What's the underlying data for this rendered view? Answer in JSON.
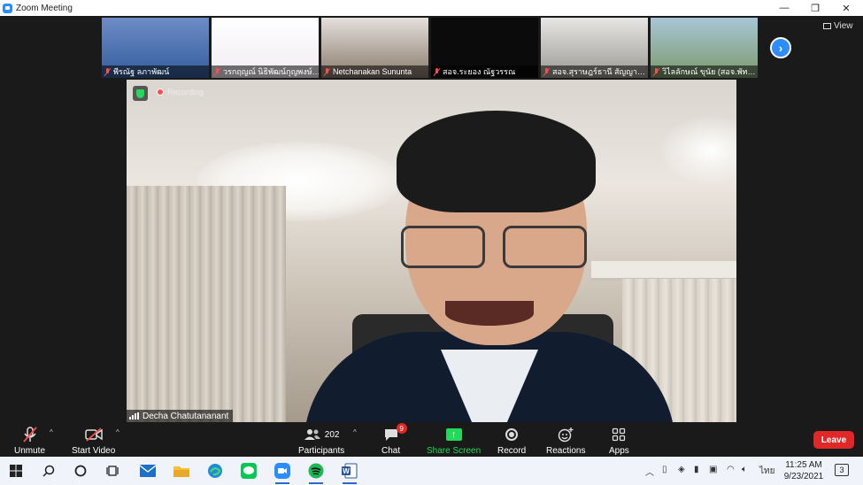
{
  "window": {
    "title": "Zoom Meeting",
    "controls": [
      "minimize",
      "restore",
      "close"
    ]
  },
  "view_button": {
    "label": "View"
  },
  "gallery": [
    {
      "name": "พีรณัฐ ลภาพัฒน์",
      "muted": true,
      "tile_colors": [
        "#6d8cc6",
        "#345d9c"
      ]
    },
    {
      "name": "วรกฤญณ์ นิธิพัฒน์กุญพงษ์…",
      "muted": true,
      "tile_colors": [
        "#ffffff",
        "#f1ecf3"
      ]
    },
    {
      "name": "Netchanakan Sununta",
      "muted": true,
      "tile_colors": [
        "#e4e0dc",
        "#8a7a6c"
      ]
    },
    {
      "name": "สอจ.ระยอง ณัฐวรรณ",
      "muted": true,
      "tile_colors": [
        "#0b0b0b",
        "#0b0b0b"
      ]
    },
    {
      "name": "สอจ.สุราษฎร์ธานี สัญญา…",
      "muted": true,
      "tile_colors": [
        "#e6e6e4",
        "#9c9993"
      ]
    },
    {
      "name": "วิไลลักษณ์ ขุนัย (สอจ.พัท…",
      "muted": true,
      "tile_colors": [
        "#a9c6d8",
        "#7b9a6a"
      ]
    }
  ],
  "speaker": {
    "name": "Decha Chatutananant",
    "recording_label": "Recording"
  },
  "toolbar": {
    "unmute": "Unmute",
    "start_video": "Start Video",
    "participants": "Participants",
    "participants_count": "202",
    "chat": "Chat",
    "chat_badge": "9",
    "share_screen": "Share Screen",
    "record": "Record",
    "reactions": "Reactions",
    "apps": "Apps",
    "leave": "Leave"
  },
  "colors": {
    "zoom_blue": "#2d8cff",
    "share_green": "#23d959",
    "leave_red": "#e02828",
    "muted_red": "#ff4d4d"
  },
  "taskbar": {
    "apps": [
      "windows-start",
      "search",
      "cortana",
      "task-view",
      "mail",
      "file-explorer",
      "edge",
      "line",
      "zoom",
      "spotify",
      "word"
    ],
    "input_language": "ไทย",
    "time": "11:25 AM",
    "date": "9/23/2021",
    "notification_count": "3"
  }
}
